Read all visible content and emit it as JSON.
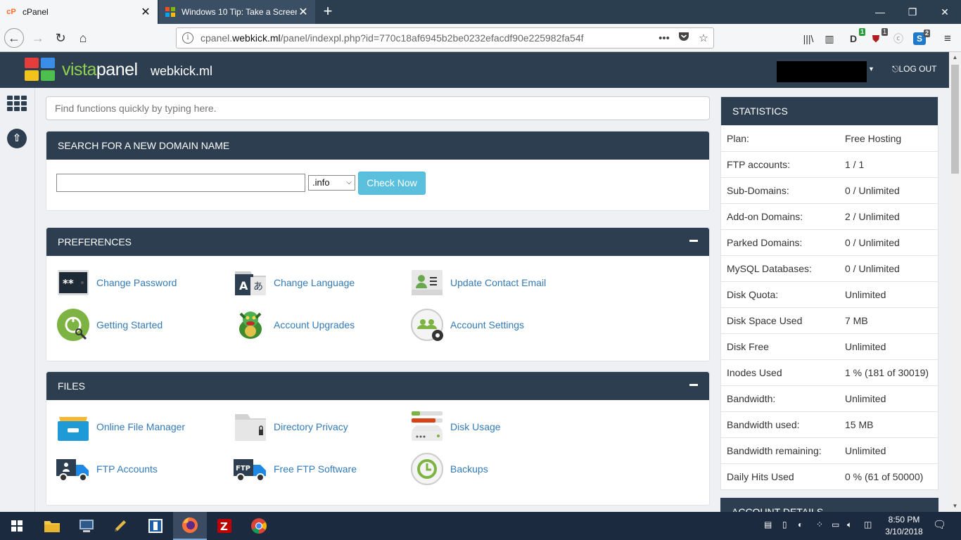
{
  "browser": {
    "tabs": [
      {
        "label": "cPanel",
        "favicon_color": "#ff6c2c"
      },
      {
        "label": "Windows 10 Tip: Take a Screen"
      }
    ],
    "url": {
      "prefix": "cpanel.",
      "host": "webkick.ml",
      "path": "/panel/indexpl.php?id=770c18af6945b2be0232efacdf90e225982fa54f"
    },
    "badges": {
      "ext1": "1",
      "ext2": "1",
      "ext3": "2"
    }
  },
  "header": {
    "brand_a": "vista",
    "brand_b": "panel",
    "domain": "webkick.ml",
    "logout": "LOG OUT"
  },
  "quicksearch": {
    "placeholder": "Find functions quickly by typing here."
  },
  "domain_search": {
    "title": "SEARCH FOR A NEW DOMAIN NAME",
    "tld": ".info",
    "button": "Check Now"
  },
  "preferences": {
    "title": "PREFERENCES",
    "items": [
      {
        "label": "Change Password"
      },
      {
        "label": "Change Language"
      },
      {
        "label": "Update Contact Email"
      },
      {
        "label": "Getting Started"
      },
      {
        "label": "Account Upgrades"
      },
      {
        "label": "Account Settings"
      }
    ]
  },
  "files": {
    "title": "FILES",
    "items": [
      {
        "label": "Online File Manager"
      },
      {
        "label": "Directory Privacy"
      },
      {
        "label": "Disk Usage"
      },
      {
        "label": "FTP Accounts"
      },
      {
        "label": "Free FTP Software"
      },
      {
        "label": "Backups"
      }
    ]
  },
  "statistics": {
    "title": "STATISTICS",
    "rows": [
      {
        "k": "Plan:",
        "v": "Free Hosting"
      },
      {
        "k": "FTP accounts:",
        "v": "1 / 1"
      },
      {
        "k": "Sub-Domains:",
        "v": "0 / Unlimited"
      },
      {
        "k": "Add-on Domains:",
        "v": "2 / Unlimited"
      },
      {
        "k": "Parked Domains:",
        "v": "0 / Unlimited"
      },
      {
        "k": "MySQL Databases:",
        "v": "0 / Unlimited"
      },
      {
        "k": "Disk Quota:",
        "v": "Unlimited"
      },
      {
        "k": "Disk Space Used",
        "v": "7 MB"
      },
      {
        "k": "Disk Free",
        "v": "Unlimited"
      },
      {
        "k": "Inodes Used",
        "v": "1 % (181 of 30019)"
      },
      {
        "k": "Bandwidth:",
        "v": "Unlimited"
      },
      {
        "k": "Bandwidth used:",
        "v": "15 MB"
      },
      {
        "k": "Bandwidth remaining:",
        "v": "Unlimited"
      },
      {
        "k": "Daily Hits Used",
        "v": "0 % (61 of 50000)"
      }
    ],
    "next_title": "ACCOUNT DETAILS"
  },
  "taskbar": {
    "time": "8:50 PM",
    "date": "3/10/2018"
  },
  "colors": {
    "header": "#2c3e50",
    "link": "#337ab7",
    "button": "#5bc0de",
    "brand_accent": "#8fd14f"
  }
}
